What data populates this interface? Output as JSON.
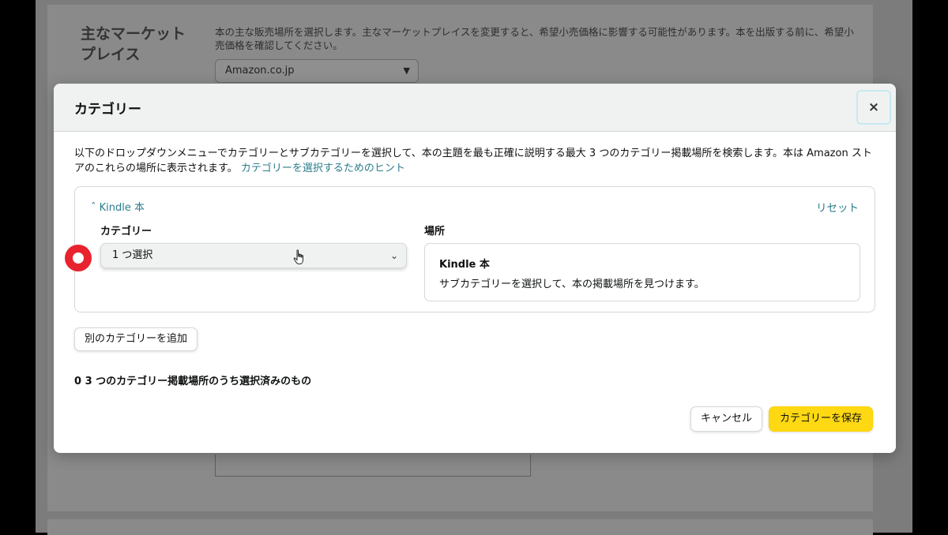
{
  "background_page": {
    "section_title": "主なマーケットプレイス",
    "section_description": "本の主な販売場所を選択します。主なマーケットプレイスを変更すると、希望小売価格に影響する可能性があります。本を出版する前に、希望小売価格を確認してください。",
    "marketplace_value": "Amazon.co.jp"
  },
  "modal": {
    "title": "カテゴリー",
    "close_label": "×",
    "intro_text": "以下のドロップダウンメニューでカテゴリーとサブカテゴリーを選択して、本の主題を最も正確に説明する最大 3 つのカテゴリー掲載場所を検索します。本は Amazon ストアのこれらの場所に表示されます。",
    "intro_link": "カテゴリーを選択するためのヒント",
    "panel": {
      "toggle_label": "Kindle 本",
      "reset_label": "リセット",
      "category_label": "カテゴリー",
      "category_select_value": "1 つ選択",
      "location_label": "場所",
      "location_title": "Kindle 本",
      "location_desc": "サブカテゴリーを選択して、本の掲載場所を見つけます。"
    },
    "add_category_label": "別のカテゴリーを追加",
    "selected_count_text": "0 3 つのカテゴリー掲載場所のうち選択済みのもの",
    "cancel_label": "キャンセル",
    "save_label": "カテゴリーを保存"
  },
  "colors": {
    "link": "#2a7d8c",
    "primary_button": "#ffd814",
    "click_marker": "#e8232e"
  }
}
